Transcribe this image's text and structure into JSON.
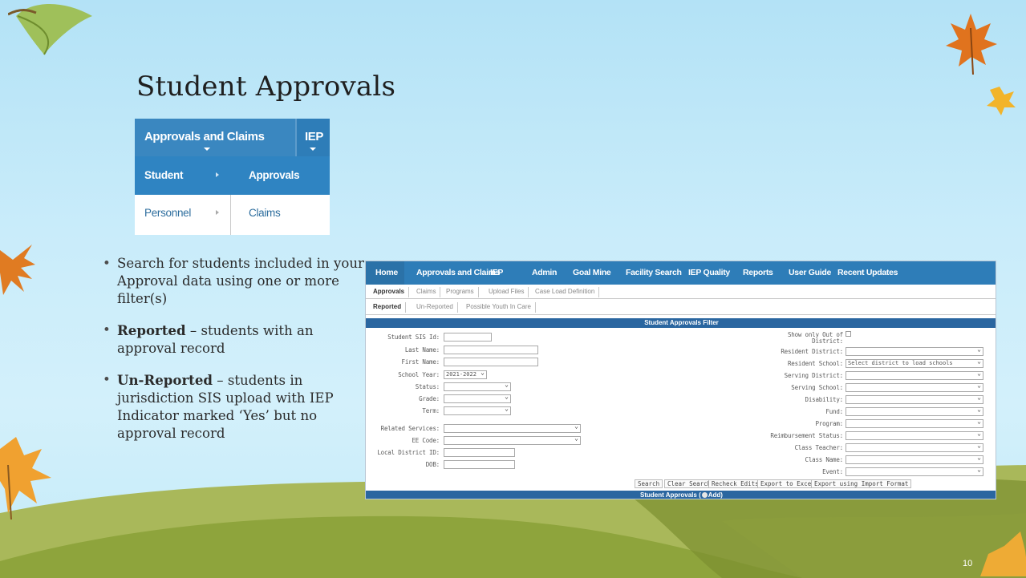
{
  "slide": {
    "title": "Student Approvals",
    "number": "10"
  },
  "menu_crop": {
    "top_tabs": [
      "Approvals and Claims",
      "IEP"
    ],
    "left_items": [
      "Student",
      "Personnel"
    ],
    "right_items": [
      "Approvals",
      "Claims"
    ]
  },
  "bullets": [
    {
      "bold": "",
      "text": "Search for students included in your Approval data using one or more filter(s)"
    },
    {
      "bold": "Reported",
      "text": " – students with an approval record"
    },
    {
      "bold": "Un-Reported",
      "text": " – students in jurisdiction SIS upload with IEP Indicator marked ‘Yes’ but no approval record"
    }
  ],
  "app": {
    "nav": [
      "Home",
      "Approvals and Claims",
      "IEP",
      "Admin",
      "Goal Mine",
      "Facility Search",
      "IEP Quality",
      "Reports",
      "User Guide",
      "Recent Updates"
    ],
    "tabs1": [
      "Approvals",
      "Claims",
      "Programs",
      "Upload Files",
      "Case Load Definition"
    ],
    "tabs2": [
      "Reported",
      "Un-Reported",
      "Possible Youth In Care"
    ],
    "filter_title": "Student Approvals Filter",
    "left_fields": {
      "student_sis_id": "Student SIS Id:",
      "last_name": "Last Name:",
      "first_name": "First Name:",
      "school_year": "School Year:",
      "school_year_value": "2021-2022",
      "status": "Status:",
      "grade": "Grade:",
      "term": "Term:",
      "related_services": "Related Services:",
      "ee_code": "EE Code:",
      "local_district_id": "Local District ID:",
      "dob": "DOB:"
    },
    "right_fields": {
      "show_only_out_of": "Show only Out of",
      "district": "District:",
      "resident_district": "Resident District:",
      "resident_school": "Resident School:",
      "resident_school_value": "Select district to load schools",
      "serving_district": "Serving District:",
      "serving_school": "Serving School:",
      "disability": "Disability:",
      "fund": "Fund:",
      "program": "Program:",
      "reimbursement_status": "Reimbursement Status:",
      "class_teacher": "Class Teacher:",
      "class_name": "Class Name:",
      "event": "Event:"
    },
    "buttons": [
      "Search",
      "Clear Search",
      "Recheck Edits",
      "Export to Excel",
      "Export using Import Format"
    ],
    "approvals_title": "Student Approvals (",
    "add_label": "Add)"
  },
  "colors": {
    "nav_blue": "#2e7db8",
    "header_blue": "#2a66a0",
    "hill_green": "#9cae4e",
    "hill_dark": "#6f7f2f",
    "leaf_orange": "#e58a24"
  },
  "icons": [
    "leaf-icon",
    "maple-leaf-icon",
    "add-icon",
    "dropdown-arrow-icon"
  ]
}
